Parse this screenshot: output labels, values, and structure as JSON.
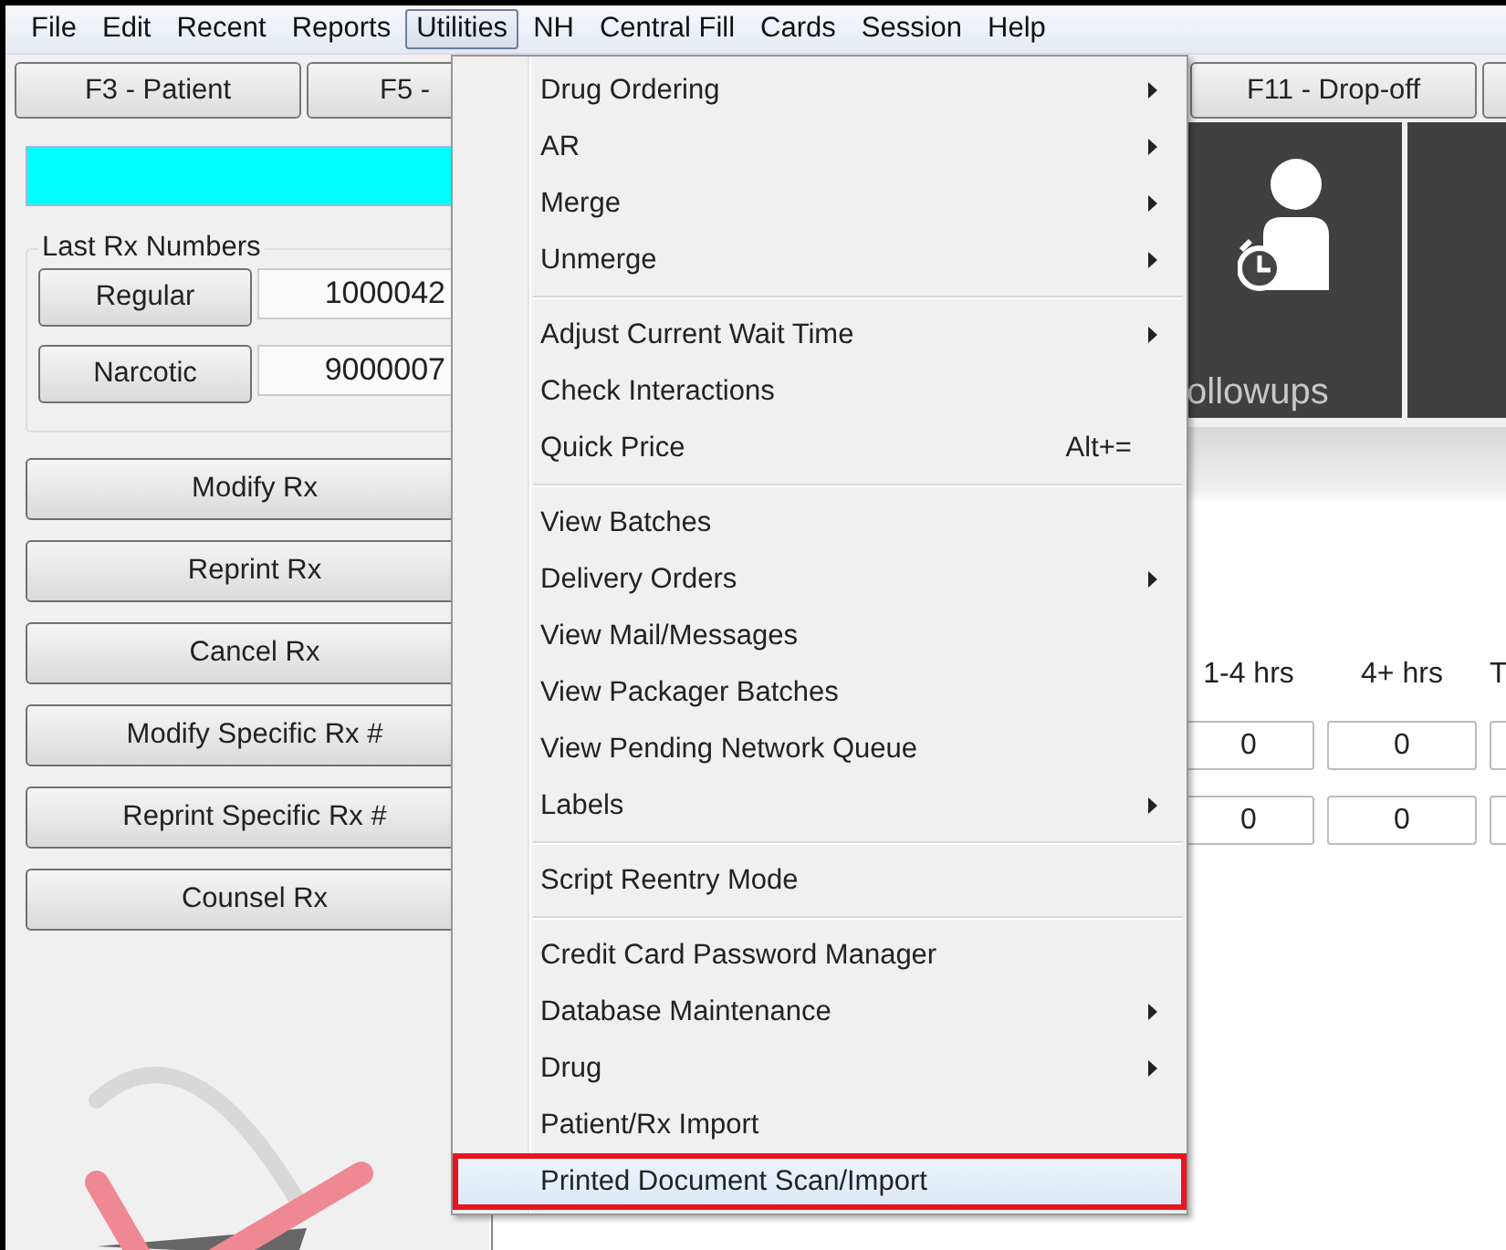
{
  "menubar": [
    {
      "label": "File",
      "selected": false
    },
    {
      "label": "Edit",
      "selected": false
    },
    {
      "label": "Recent",
      "selected": false
    },
    {
      "label": "Reports",
      "selected": false
    },
    {
      "label": "Utilities",
      "selected": true
    },
    {
      "label": "NH",
      "selected": false
    },
    {
      "label": "Central Fill",
      "selected": false
    },
    {
      "label": "Cards",
      "selected": false
    },
    {
      "label": "Session",
      "selected": false
    },
    {
      "label": "Help",
      "selected": false
    }
  ],
  "toolbar": {
    "left_buttons": [
      "F3 - Patient",
      "F5 -"
    ],
    "right_buttons": [
      "F11 - Drop-off"
    ]
  },
  "last_rx": {
    "title": "Last Rx Numbers",
    "rows": [
      {
        "button": "Regular",
        "value": "1000042"
      },
      {
        "button": "Narcotic",
        "value": "9000007"
      }
    ]
  },
  "actions": [
    "Modify Rx",
    "Reprint Rx",
    "Cancel Rx",
    "Modify Specific Rx #",
    "Reprint Specific Rx #",
    "Counsel Rx"
  ],
  "tiles": [
    {
      "label": "ollowups"
    }
  ],
  "wait_table": {
    "columns": [
      "1-4 hrs",
      "4+ hrs",
      "T"
    ],
    "rows": [
      [
        "0",
        "0"
      ],
      [
        "0",
        "0"
      ]
    ]
  },
  "utilities_menu": [
    {
      "kind": "item",
      "label": "Drug Ordering",
      "submenu": true,
      "selected": false
    },
    {
      "kind": "item",
      "label": "AR",
      "submenu": true,
      "selected": false
    },
    {
      "kind": "item",
      "label": "Merge",
      "submenu": true,
      "selected": false
    },
    {
      "kind": "item",
      "label": "Unmerge",
      "submenu": true,
      "selected": false
    },
    {
      "kind": "separator"
    },
    {
      "kind": "item",
      "label": "Adjust Current Wait Time",
      "submenu": true,
      "selected": false
    },
    {
      "kind": "item",
      "label": "Check Interactions",
      "submenu": false,
      "selected": false
    },
    {
      "kind": "item",
      "label": "Quick Price",
      "shortcut": "Alt+=",
      "submenu": false,
      "selected": false
    },
    {
      "kind": "separator"
    },
    {
      "kind": "item",
      "label": "View Batches",
      "submenu": false,
      "selected": false
    },
    {
      "kind": "item",
      "label": "Delivery Orders",
      "submenu": true,
      "selected": false
    },
    {
      "kind": "item",
      "label": "View Mail/Messages",
      "submenu": false,
      "selected": false
    },
    {
      "kind": "item",
      "label": "View Packager Batches",
      "submenu": false,
      "selected": false
    },
    {
      "kind": "item",
      "label": "View Pending Network Queue",
      "submenu": false,
      "selected": false
    },
    {
      "kind": "item",
      "label": "Labels",
      "submenu": true,
      "selected": false
    },
    {
      "kind": "separator"
    },
    {
      "kind": "item",
      "label": "Script Reentry Mode",
      "submenu": false,
      "selected": false
    },
    {
      "kind": "separator"
    },
    {
      "kind": "item",
      "label": "Credit Card Password Manager",
      "submenu": false,
      "selected": false
    },
    {
      "kind": "item",
      "label": "Database Maintenance",
      "submenu": true,
      "selected": false
    },
    {
      "kind": "item",
      "label": "Drug",
      "submenu": true,
      "selected": false
    },
    {
      "kind": "item",
      "label": "Patient/Rx Import",
      "submenu": false,
      "selected": false
    },
    {
      "kind": "item",
      "label": "Printed Document Scan/Import",
      "submenu": false,
      "selected": true
    }
  ]
}
